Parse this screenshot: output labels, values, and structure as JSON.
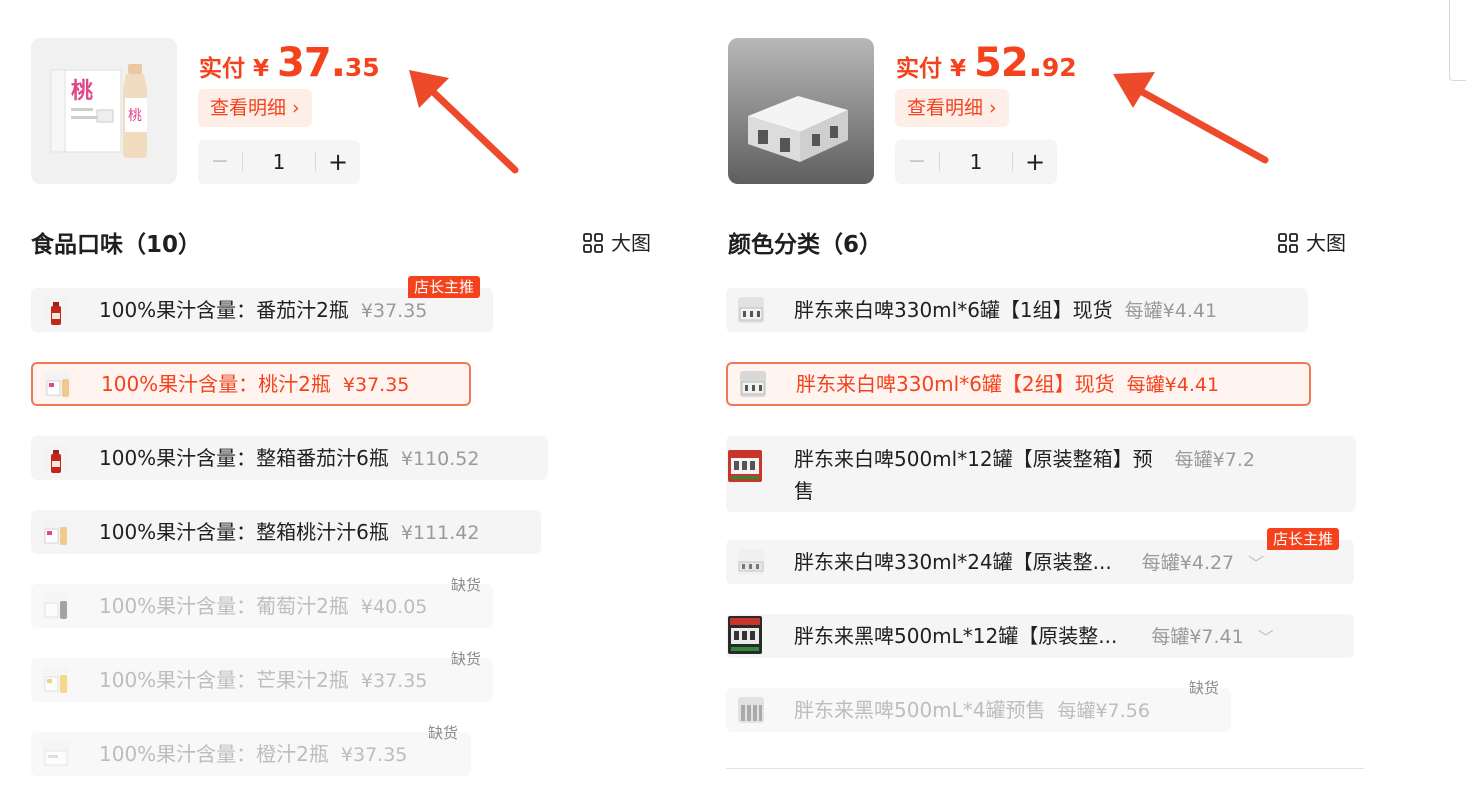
{
  "left": {
    "price": {
      "label": "实付 ¥ ",
      "int": "37.",
      "dec": "35"
    },
    "detail_btn": "查看明细 ›",
    "stepper": {
      "minus": "−",
      "qty": "1",
      "plus": "+"
    },
    "section_title": "食品口味（10）",
    "bigview_label": "大图",
    "options": [
      {
        "label": "100%果汁含量：番茄汁2瓶",
        "price": "¥37.35",
        "tag": "店长主推"
      },
      {
        "label": "100%果汁含量：桃汁2瓶",
        "price": "¥37.35",
        "selected": true
      },
      {
        "label": "100%果汁含量：整箱番茄汁6瓶",
        "price": "¥110.52"
      },
      {
        "label": "100%果汁含量：整箱桃汁汁6瓶",
        "price": "¥111.42"
      },
      {
        "label": "100%果汁含量：葡萄汁2瓶",
        "price": "¥40.05",
        "oos": "缺货"
      },
      {
        "label": "100%果汁含量：芒果汁2瓶",
        "price": "¥37.35",
        "oos": "缺货"
      },
      {
        "label": "100%果汁含量：橙汁2瓶",
        "price": "¥37.35",
        "oos": "缺货"
      }
    ]
  },
  "right": {
    "price": {
      "label": "实付 ¥ ",
      "int": "52.",
      "dec": "92"
    },
    "detail_btn": "查看明细 ›",
    "stepper": {
      "minus": "−",
      "qty": "1",
      "plus": "+"
    },
    "section_title": "颜色分类（6）",
    "bigview_label": "大图",
    "options": [
      {
        "label": "胖东来白啤330ml*6罐【1组】现货",
        "price": "每罐¥4.41"
      },
      {
        "label": "胖东来白啤330ml*6罐【2组】现货",
        "price": "每罐¥4.41",
        "selected": true
      },
      {
        "label_line1": "胖东来白啤500ml*12罐【原装整箱】预",
        "label_line2": "售",
        "price": "每罐¥7.2"
      },
      {
        "label": "胖东来白啤330ml*24罐【原装整...",
        "price": "每罐¥4.27",
        "tag": "店长主推",
        "chevron": "﹀"
      },
      {
        "label": "胖东来黑啤500mL*12罐【原装整...",
        "price": "每罐¥7.41",
        "chevron": "﹀"
      },
      {
        "label": "胖东来黑啤500mL*4罐预售",
        "price": "每罐¥7.56",
        "oos": "缺货"
      }
    ]
  },
  "colors": {
    "accent": "#f4431c",
    "selected_border": "#f07a55",
    "option_bg": "#f5f5f5",
    "muted": "#9a9a9a",
    "disabled": "#bdbdbd"
  }
}
